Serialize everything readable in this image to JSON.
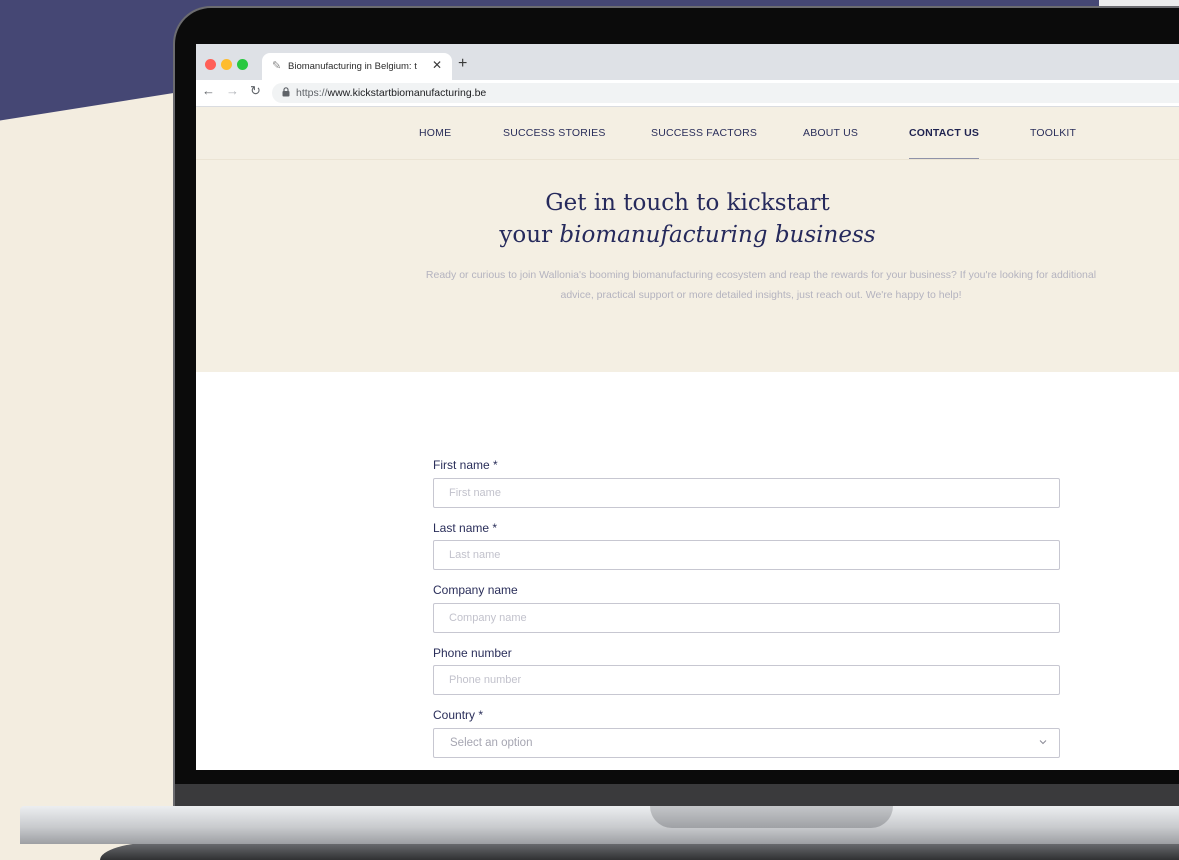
{
  "browser": {
    "tab_title": "Biomanufacturing in Belgium: t",
    "tab_close": "✕",
    "new_tab": "+",
    "url_prefix": "https://",
    "url_domain": "www.kickstartbiomanufacturing.be",
    "traffic_colors": [
      "#ff5f57",
      "#febc2e",
      "#28c840"
    ]
  },
  "nav": {
    "items": [
      "HOME",
      "SUCCESS STORIES",
      "SUCCESS FACTORS",
      "ABOUT US",
      "CONTACT US",
      "TOOLKIT"
    ],
    "active": "CONTACT US"
  },
  "hero": {
    "title_line1": "Get in touch to kickstart",
    "title_line2_prefix": "your ",
    "title_line2_italic": "biomanufacturing business",
    "description": "Ready or curious to join Wallonia's booming biomanufacturing ecosystem and reap the rewards for your business? If you're looking for additional advice, practical support or more detailed insights, just reach out. We're happy to help!"
  },
  "form": {
    "first_name": {
      "label": "First name *",
      "placeholder": "First name",
      "value": ""
    },
    "last_name": {
      "label": "Last name *",
      "placeholder": "Last name",
      "value": ""
    },
    "company_name": {
      "label": "Company name",
      "placeholder": "Company name",
      "value": ""
    },
    "phone_number": {
      "label": "Phone number",
      "placeholder": "Phone number",
      "value": ""
    },
    "country": {
      "label": "Country *",
      "selected": "Select an option"
    }
  },
  "colors": {
    "navy_background": "#454774",
    "cream_background": "#f3ede0",
    "hero_background": "#f4efe3",
    "heading_navy": "#262a5c"
  }
}
